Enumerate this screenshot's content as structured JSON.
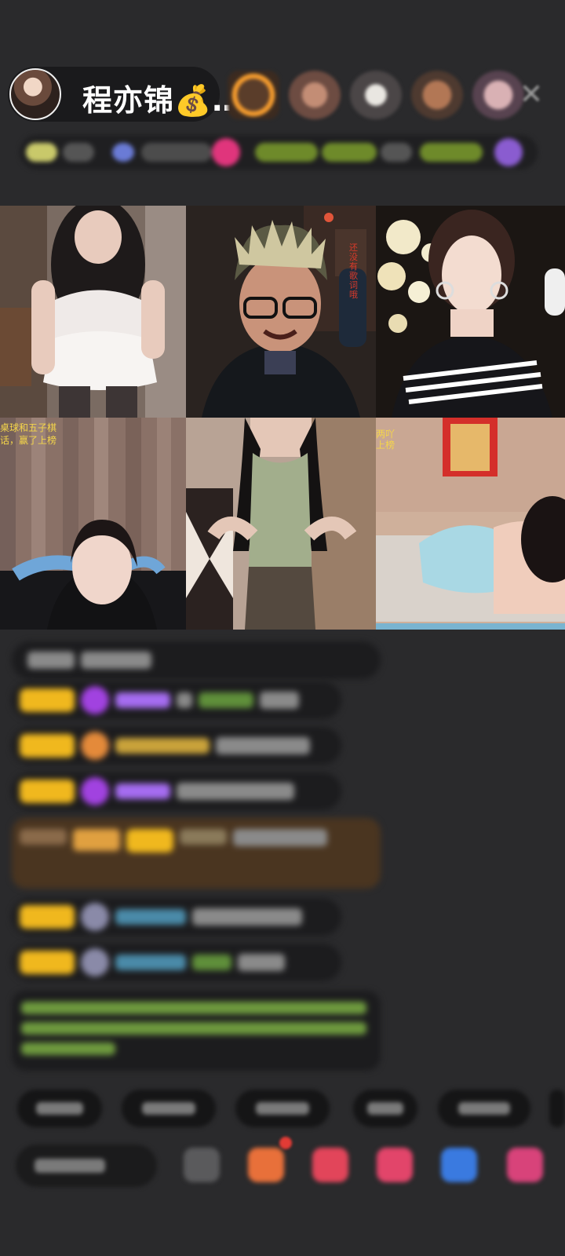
{
  "header": {
    "host_name": "程亦锦💰…"
  },
  "video_grid": {
    "tiles": [
      {
        "id": "tile-1"
      },
      {
        "id": "tile-2",
        "caption": "还没有歌词哦"
      },
      {
        "id": "tile-3"
      },
      {
        "id": "tile-4",
        "caption_line1": "桌球和五子棋",
        "caption_line2": "话，赢了上榜"
      },
      {
        "id": "tile-5"
      },
      {
        "id": "tile-6",
        "caption_line1": "两吖",
        "caption_line2": "上榜"
      }
    ]
  },
  "colors": {
    "background": "#2a2a2c",
    "level_badge": "#f0b81e",
    "accent_pink": "#e0357c",
    "chat_green": "#7fbf4a",
    "chat_purple": "#a56cf0"
  }
}
